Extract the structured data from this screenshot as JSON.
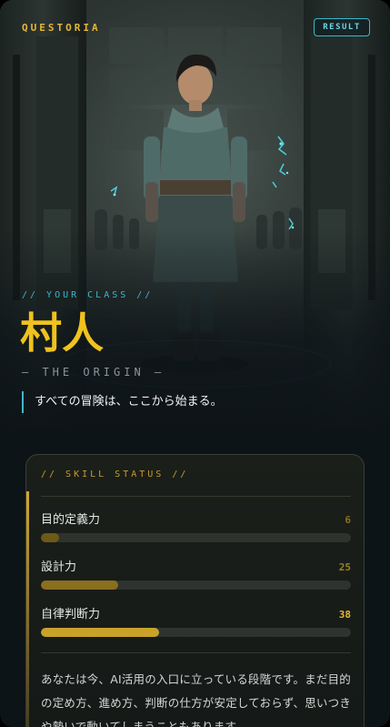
{
  "header": {
    "brand": "QUESTORIA",
    "result_label": "RESULT"
  },
  "hero": {
    "your_class_label": "// YOUR CLASS //",
    "class_name": "村人",
    "origin_label": "— THE ORIGIN —",
    "tagline": "すべての冒険は、ここから始まる。"
  },
  "status": {
    "title": "// SKILL STATUS //",
    "scale_max": 100,
    "skills": [
      {
        "name": "目的定義力",
        "value": "6",
        "level": 6,
        "value_color": "#8a6f22",
        "fill_color": "#6e5a18"
      },
      {
        "name": "設計力",
        "value": "25",
        "level": 25,
        "value_color": "#9e7f26",
        "fill_color": "#8a6f1e"
      },
      {
        "name": "自律判断力",
        "value": "38",
        "level": 38,
        "value_color": "#e6b535",
        "fill_color": "#c9a22a"
      }
    ],
    "description": "あなたは今、AI活用の入口に立っている段階です。まだ目的の定め方、進め方、判断の仕方が安定しておらず、思いつきや勢いで動いてしまうこともあります。"
  },
  "colors": {
    "accent_gold": "#f0c21e",
    "accent_cyan": "#3fb6c9",
    "background": "#0d1418"
  }
}
